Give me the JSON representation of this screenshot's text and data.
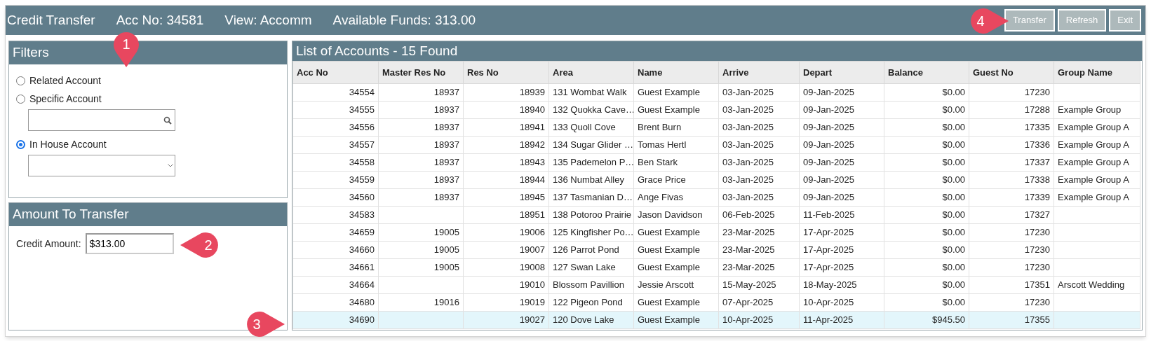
{
  "header": {
    "title": "Credit Transfer",
    "fields": [
      "Acc No: 34581",
      "View: Accomm",
      "Available Funds: 313.00"
    ],
    "buttons": [
      "Transfer",
      "Refresh",
      "Exit"
    ]
  },
  "filters": {
    "title": "Filters",
    "options": [
      {
        "kind": "plain",
        "label": "Related Account",
        "selected": false
      },
      {
        "kind": "search",
        "label": "Specific Account",
        "selected": false
      },
      {
        "kind": "dropdown",
        "label": "In House Account",
        "selected": true
      }
    ]
  },
  "amount": {
    "title": "Amount To Transfer",
    "label": "Credit Amount:",
    "value": "$313.00"
  },
  "accounts": {
    "title": "List of Accounts - 15 Found",
    "columns": [
      "Acc No",
      "Master Res No",
      "Res No",
      "Area",
      "Name",
      "Arrive",
      "Depart",
      "Balance",
      "Guest No",
      "Group Name"
    ],
    "rows": [
      {
        "acc_no": "34554",
        "master_res_no": "18937",
        "res_no": "18939",
        "area": "131 Wombat Walk",
        "name": "Guest Example",
        "arrive": "03-Jan-2025",
        "depart": "09-Jan-2025",
        "balance": "$0.00",
        "guest_no": "17230",
        "selected": false
      },
      {
        "acc_no": "34555",
        "master_res_no": "18937",
        "res_no": "18940",
        "area": "132 Quokka Cave…",
        "name": "Guest Example",
        "arrive": "03-Jan-2025",
        "depart": "09-Jan-2025",
        "balance": "$0.00",
        "guest_no": "17288",
        "group_name": "Example Group",
        "selected": false
      },
      {
        "acc_no": "34556",
        "master_res_no": "18937",
        "res_no": "18941",
        "area": "133 Quoll Cove",
        "name": "Brent Burn",
        "arrive": "03-Jan-2025",
        "depart": "09-Jan-2025",
        "balance": "$0.00",
        "guest_no": "17335",
        "group_name": "Example Group A",
        "selected": false
      },
      {
        "acc_no": "34557",
        "master_res_no": "18937",
        "res_no": "18942",
        "area": "134 Sugar Glider …",
        "name": "Tomas Hertl",
        "arrive": "03-Jan-2025",
        "depart": "09-Jan-2025",
        "balance": "$0.00",
        "guest_no": "17336",
        "group_name": "Example Group A",
        "selected": false
      },
      {
        "acc_no": "34558",
        "master_res_no": "18937",
        "res_no": "18943",
        "area": "135 Pademelon P…",
        "name": "Ben Stark",
        "arrive": "03-Jan-2025",
        "depart": "09-Jan-2025",
        "balance": "$0.00",
        "guest_no": "17337",
        "group_name": "Example Group A",
        "selected": false
      },
      {
        "acc_no": "34559",
        "master_res_no": "18937",
        "res_no": "18944",
        "area": "136 Numbat Alley",
        "name": "Grace Price",
        "arrive": "03-Jan-2025",
        "depart": "09-Jan-2025",
        "balance": "$0.00",
        "guest_no": "17338",
        "group_name": "Example Group A",
        "selected": false
      },
      {
        "acc_no": "34560",
        "master_res_no": "18937",
        "res_no": "18945",
        "area": "137 Tasmanian D…",
        "name": "Ange Fivas",
        "arrive": "03-Jan-2025",
        "depart": "09-Jan-2025",
        "balance": "$0.00",
        "guest_no": "17339",
        "group_name": "Example Group A",
        "selected": false
      },
      {
        "acc_no": "34583",
        "res_no": "18951",
        "area": "138 Potoroo Prairie",
        "name": "Jason Davidson",
        "arrive": "06-Feb-2025",
        "depart": "11-Feb-2025",
        "balance": "$0.00",
        "guest_no": "17327",
        "selected": false
      },
      {
        "acc_no": "34659",
        "master_res_no": "19005",
        "res_no": "19006",
        "area": "125 Kingfisher Po…",
        "name": "Guest Example",
        "arrive": "23-Mar-2025",
        "depart": "17-Apr-2025",
        "balance": "$0.00",
        "guest_no": "17230",
        "selected": false
      },
      {
        "acc_no": "34660",
        "master_res_no": "19005",
        "res_no": "19007",
        "area": "126 Parrot Pond",
        "name": "Guest Example",
        "arrive": "23-Mar-2025",
        "depart": "17-Apr-2025",
        "balance": "$0.00",
        "guest_no": "17230",
        "selected": false
      },
      {
        "acc_no": "34661",
        "master_res_no": "19005",
        "res_no": "19008",
        "area": "127 Swan Lake",
        "name": "Guest Example",
        "arrive": "23-Mar-2025",
        "depart": "17-Apr-2025",
        "balance": "$0.00",
        "guest_no": "17230",
        "selected": false
      },
      {
        "acc_no": "34664",
        "res_no": "19010",
        "area": "Blossom Pavillion",
        "name": "Jessie Arscott",
        "arrive": "15-May-2025",
        "depart": "18-May-2025",
        "balance": "$0.00",
        "guest_no": "17351",
        "group_name": "Arscott Wedding",
        "selected": false
      },
      {
        "acc_no": "34680",
        "master_res_no": "19016",
        "res_no": "19019",
        "area": "122 Pigeon Pond",
        "name": "Guest Example",
        "arrive": "07-Apr-2025",
        "depart": "10-Apr-2025",
        "balance": "$0.00",
        "guest_no": "17230",
        "selected": false
      },
      {
        "acc_no": "34690",
        "res_no": "19027",
        "area": "120 Dove Lake",
        "name": "Guest Example",
        "arrive": "10-Apr-2025",
        "depart": "11-Apr-2025",
        "balance": "$945.50",
        "guest_no": "17355",
        "selected": true
      }
    ]
  },
  "callouts": [
    {
      "number": "1",
      "kind": "down"
    },
    {
      "number": "2",
      "kind": "left"
    },
    {
      "number": "3",
      "kind": "right"
    },
    {
      "number": "4",
      "kind": "right"
    }
  ]
}
